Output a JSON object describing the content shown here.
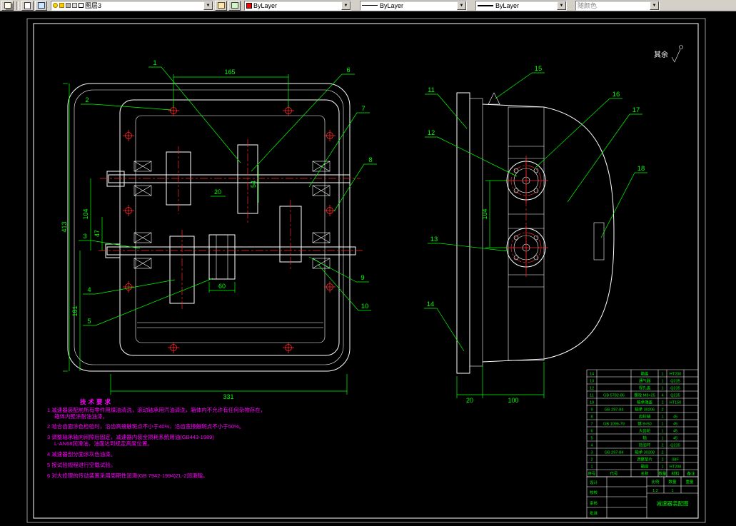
{
  "toolbar": {
    "layer_combo": {
      "value": "图层3"
    },
    "color_combo": {
      "value": "ByLayer"
    },
    "linetype_combo": {
      "value": "ByLayer"
    },
    "lineweight_combo": {
      "value": "ByLayer"
    },
    "plotstyle_combo": {
      "value": "随颜色"
    }
  },
  "annotation": {
    "surface_note": "其余"
  },
  "callouts": {
    "c1": "1",
    "c2": "2",
    "c3": "3",
    "c4": "4",
    "c5": "5",
    "c6": "6",
    "c7": "7",
    "c8": "8",
    "c9": "9",
    "c10": "10",
    "c11": "11",
    "c12": "12",
    "c13": "13",
    "c14": "14",
    "c15": "15",
    "c16": "16",
    "c17": "17",
    "c18": "18"
  },
  "dims": {
    "top_width": "165",
    "left_total_height": "413",
    "shaft_center_distance": "104",
    "mid_offset": "47",
    "lower_height": "181",
    "bottom_width": "331",
    "hub_width": "60",
    "gear_width": "20",
    "gear2_width": "54",
    "side_center_distance": "104",
    "side_plate_width": "20",
    "side_body_width": "100"
  },
  "tech_notes": {
    "title": "技术要求",
    "lines": [
      "1 减速器装配前所有零件用煤油清洗，滚动轴承用汽油清洗，箱体内不允许有任何杂物存在，",
      "箱体内壁涂耐油油漆。",
      "2 啮合齿面涂色检验时，沿齿高接触斑点不小于40%，沿齿宽接触斑点不小于50%。",
      "3 调整轴承轴向间隙后固定，减速器内装全损耗系统用油(GB443-1989)",
      "L-AN68润滑油，油面达到规定高度位置。",
      "4 减速器剖分面涂灰色油漆。",
      "5 按试验规程进行空载试验。",
      "6 对大修理的传动装置采用周期性润滑(GB 7942-1994)ZL-2润滑脂。"
    ]
  },
  "bom": {
    "header": [
      "序号",
      "代号",
      "名称",
      "数量",
      "材料",
      "备注"
    ],
    "rows": [
      [
        "14",
        "",
        "箱盖",
        "1",
        "HT200"
      ],
      [
        "13",
        "",
        "通气器",
        "1",
        "Q235"
      ],
      [
        "12",
        "",
        "视孔盖",
        "1",
        "Q235"
      ],
      [
        "11",
        "GB 5782-86",
        "螺栓 M8×25",
        "4",
        "Q235"
      ],
      [
        "10",
        "",
        "轴承端盖",
        "2",
        "HT150"
      ],
      [
        "9",
        "GB 297-84",
        "轴承 30206",
        "2",
        ""
      ],
      [
        "8",
        "",
        "齿轮轴",
        "1",
        "45"
      ],
      [
        "7",
        "GB 1096-79",
        "键 8×50",
        "1",
        "45"
      ],
      [
        "6",
        "",
        "大齿轮",
        "1",
        "45"
      ],
      [
        "5",
        "",
        "轴",
        "1",
        "45"
      ],
      [
        "4",
        "",
        "挡油环",
        "2",
        "Q235"
      ],
      [
        "3",
        "GB 297-84",
        "轴承 30208",
        "2",
        ""
      ],
      [
        "2",
        "",
        "调整垫片",
        "2",
        "08F"
      ],
      [
        "1",
        "",
        "箱座",
        "1",
        "HT200"
      ]
    ]
  },
  "title_block": {
    "designer_label": "设计",
    "checker_label": "校核",
    "auditor_label": "审核",
    "approver_label": "批准",
    "scale_label": "比例",
    "scale_value": "1:2",
    "qty_label": "数量",
    "qty_value": "1",
    "weight_label": "重量",
    "title": "减速器装配图"
  }
}
